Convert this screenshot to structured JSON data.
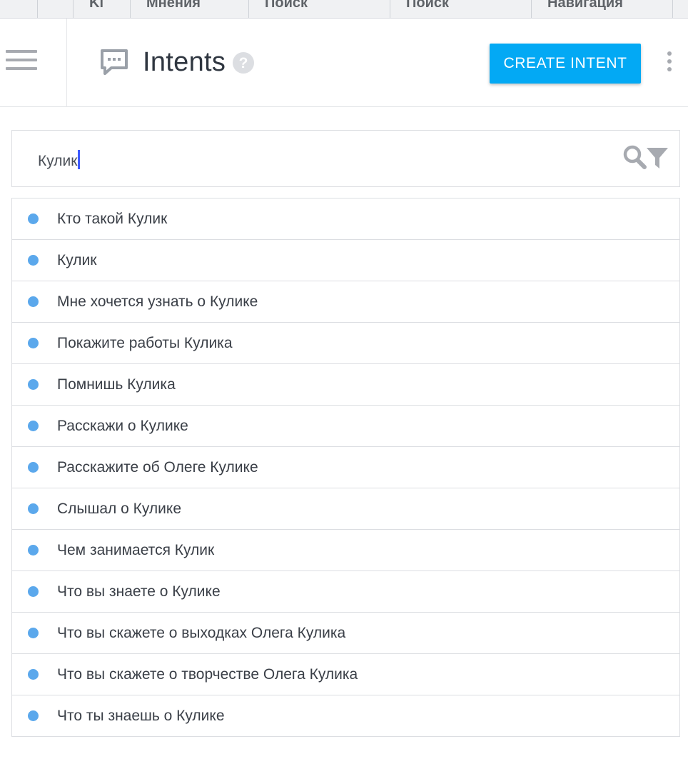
{
  "top_tabs": [
    "Ki",
    "Мнения",
    "Поиск",
    "Поиск",
    "Навигация"
  ],
  "header": {
    "title": "Intents",
    "create_button_label": "CREATE INTENT"
  },
  "icons": {
    "menu": "hamburger-menu-icon",
    "page": "chat-bubble-icon",
    "help": "question-mark-icon",
    "more": "more-vertical-icon",
    "search": "search-icon",
    "filter": "filter-icon"
  },
  "search": {
    "value": "Кулик"
  },
  "colors": {
    "accent": "#03a9f4",
    "intent_dot": "#5ba8ec",
    "caret": "#3d5afe"
  },
  "intents": [
    {
      "label": "Кто такой Кулик"
    },
    {
      "label": "Кулик"
    },
    {
      "label": "Мне хочется узнать о Кулике"
    },
    {
      "label": "Покажите работы Кулика"
    },
    {
      "label": "Помнишь Кулика"
    },
    {
      "label": "Расскажи о Кулике"
    },
    {
      "label": "Расскажите об Олеге Кулике"
    },
    {
      "label": "Слышал о Кулике"
    },
    {
      "label": "Чем занимается Кулик"
    },
    {
      "label": "Что вы знаете о Кулике"
    },
    {
      "label": "Что вы скажете о выходках Олега Кулика"
    },
    {
      "label": "Что вы скажете о творчестве Олега Кулика"
    },
    {
      "label": "Что ты знаешь о Кулике"
    }
  ]
}
